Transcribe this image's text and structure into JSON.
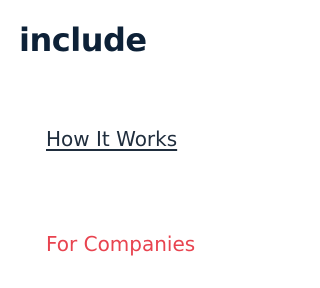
{
  "header": {
    "logo_text": "include"
  },
  "nav": {
    "how_it_works": "How It Works",
    "for_companies": "For Companies"
  },
  "colors": {
    "logo": "#0d2137",
    "link": "#1f2d3d",
    "accent": "#e8434f",
    "background": "#ffffff"
  }
}
